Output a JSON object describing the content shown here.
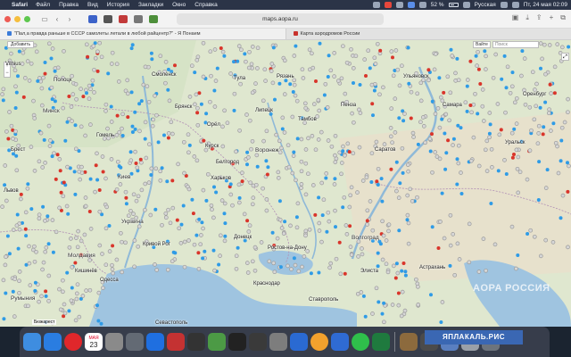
{
  "menubar": {
    "app_name": "Safari",
    "items": [
      "Файл",
      "Правка",
      "Вид",
      "История",
      "Закладки",
      "Окно",
      "Справка"
    ],
    "battery": "52 %",
    "input_source": "Русская",
    "clock": "Пт, 24 мая  02:09"
  },
  "toolbar": {
    "url": "maps.aopa.ru"
  },
  "tabs": [
    {
      "title": "\"Пал,а правда раньше в СССР самолеты летали в любой райцентр?\" - Я Понаем",
      "active": true
    },
    {
      "title": "Карта аэродромов России",
      "active": false
    }
  ],
  "map": {
    "add_button": "Добавить",
    "search_label": "Вайте",
    "search_placeholder": "Поиск",
    "zoom_in": "+",
    "zoom_out": "−",
    "scale_text": "Бюжарест",
    "watermark": "AOPA РОССИЯ",
    "cities": [
      {
        "name": "Vilnius",
        "cls": ""
      },
      {
        "name": "Полоцк",
        "cls": ""
      },
      {
        "name": "Минск",
        "cls": "big"
      },
      {
        "name": "Брест",
        "cls": ""
      },
      {
        "name": "Гомель",
        "cls": ""
      },
      {
        "name": "Львов",
        "cls": ""
      },
      {
        "name": "Киев",
        "cls": "big"
      },
      {
        "name": "Украина",
        "cls": "big"
      },
      {
        "name": "Кривой Рог",
        "cls": ""
      },
      {
        "name": "Молдавия",
        "cls": "big"
      },
      {
        "name": "Кишинёв",
        "cls": ""
      },
      {
        "name": "Румыния",
        "cls": "big"
      },
      {
        "name": "Севастополь",
        "cls": ""
      },
      {
        "name": "Одесса",
        "cls": ""
      },
      {
        "name": "Харьков",
        "cls": ""
      },
      {
        "name": "Донецк",
        "cls": ""
      },
      {
        "name": "Ростов-на-Дону",
        "cls": ""
      },
      {
        "name": "Воронеж",
        "cls": "big"
      },
      {
        "name": "Волгоград",
        "cls": "big"
      },
      {
        "name": "Саратов",
        "cls": ""
      },
      {
        "name": "Самара",
        "cls": ""
      },
      {
        "name": "Ульяновск",
        "cls": ""
      },
      {
        "name": "Пенза",
        "cls": ""
      },
      {
        "name": "Тамбов",
        "cls": ""
      },
      {
        "name": "Липецк",
        "cls": ""
      },
      {
        "name": "Курск",
        "cls": ""
      },
      {
        "name": "Белгород",
        "cls": ""
      },
      {
        "name": "Смоленск",
        "cls": ""
      },
      {
        "name": "Брянск",
        "cls": ""
      },
      {
        "name": "Орёл",
        "cls": ""
      },
      {
        "name": "Тула",
        "cls": ""
      },
      {
        "name": "Рязань",
        "cls": ""
      },
      {
        "name": "Элиста",
        "cls": ""
      },
      {
        "name": "Астрахань",
        "cls": ""
      },
      {
        "name": "Уральск",
        "cls": ""
      },
      {
        "name": "Оренбург",
        "cls": ""
      },
      {
        "name": "Краснодар",
        "cls": ""
      },
      {
        "name": "Ставрополь",
        "cls": ""
      }
    ]
  },
  "dock": {
    "calendar_month": "МАЯ",
    "calendar_day": "23",
    "overlay_label": "ЯПЛАКАЛЬ.РИС"
  },
  "colors": {
    "map_land": "#e3e8d4",
    "map_water": "#9fc4e0",
    "marker_gray": "#9a9a9a",
    "marker_blue": "#2f9be6",
    "marker_red": "#d9352b"
  }
}
